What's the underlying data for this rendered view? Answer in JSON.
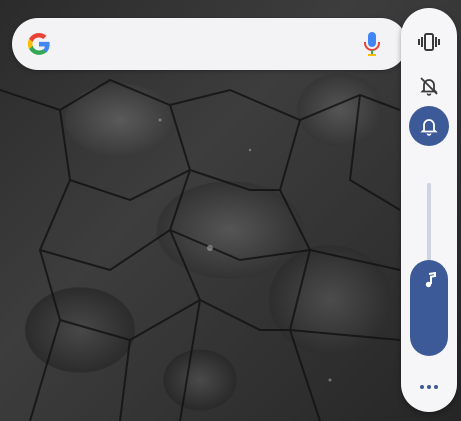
{
  "search": {
    "logo_icon": "google-g-icon",
    "mic_icon": "microphone-icon"
  },
  "volume_panel": {
    "modes": [
      {
        "name": "vibrate",
        "icon": "vibrate-icon",
        "selected": false
      },
      {
        "name": "mute",
        "icon": "bell-off-icon",
        "selected": false
      },
      {
        "name": "ring",
        "icon": "bell-icon",
        "selected": true
      }
    ],
    "slider_icon": "music-note-icon",
    "more_icon": "more-horizontal-icon"
  },
  "colors": {
    "accent": "#3d5a98",
    "panel_bg": "#f6f6f8",
    "search_bg": "#f3f3f5"
  }
}
